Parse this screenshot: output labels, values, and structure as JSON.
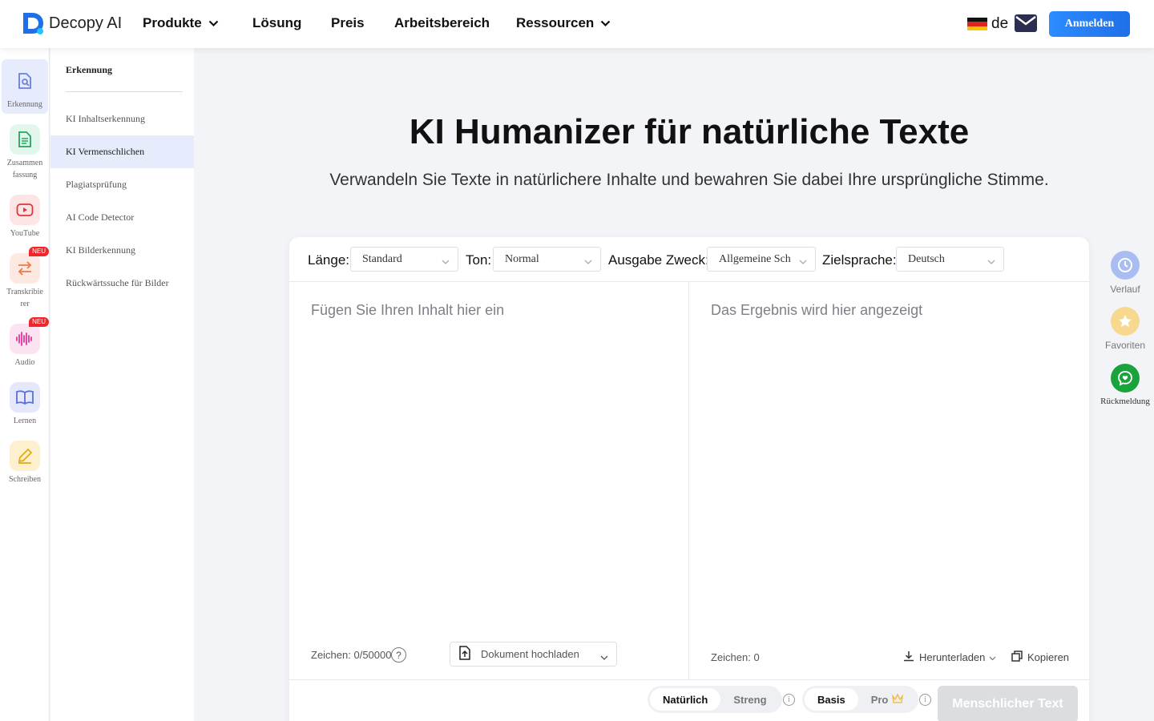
{
  "header": {
    "brand": "Decopy AI",
    "nav": [
      {
        "label": "Produkte",
        "dropdown": true
      },
      {
        "label": "Lösung",
        "dropdown": false
      },
      {
        "label": "Preis",
        "dropdown": false
      },
      {
        "label": "Arbeitsbereich",
        "dropdown": false
      },
      {
        "label": "Ressourcen",
        "dropdown": true
      }
    ],
    "lang_code": "de",
    "login_label": "Anmelden",
    "accent": "#2d8cff"
  },
  "rail": {
    "items": [
      {
        "label": "Erkennung",
        "icon": "document-search-icon",
        "active": true,
        "badge": ""
      },
      {
        "label": "Zusammen fassung",
        "icon": "document-lines-icon",
        "active": false,
        "badge": ""
      },
      {
        "label": "YouTube",
        "icon": "youtube-icon",
        "active": false,
        "badge": ""
      },
      {
        "label": "Transkribie rer",
        "icon": "arrows-swap-icon",
        "active": false,
        "badge": "NEU"
      },
      {
        "label": "Audio",
        "icon": "audio-wave-icon",
        "active": false,
        "badge": "NEU"
      },
      {
        "label": "Lernen",
        "icon": "book-icon",
        "active": false,
        "badge": ""
      },
      {
        "label": "Schreiben",
        "icon": "pen-icon",
        "active": false,
        "badge": ""
      }
    ]
  },
  "subnav": {
    "title": "Erkennung",
    "items": [
      {
        "label": "KI Inhaltserkennung",
        "active": false
      },
      {
        "label": "KI Vermenschlichen",
        "active": true
      },
      {
        "label": "Plagiatsprüfung",
        "active": false
      },
      {
        "label": "AI Code Detector",
        "active": false
      },
      {
        "label": "KI Bilderkennung",
        "active": false
      },
      {
        "label": "Rückwärtssuche für Bilder",
        "active": false
      }
    ]
  },
  "main": {
    "title": "KI Humanizer für natürliche Texte",
    "subtitle": "Verwandeln Sie Texte in natürlichere Inhalte und bewahren Sie dabei Ihre ursprüngliche Stimme."
  },
  "options": {
    "length_label": "Länge:",
    "length_value": "Standard",
    "tone_label": "Ton:",
    "tone_value": "Normal",
    "purpose_label": "Ausgabe Zweck:",
    "purpose_value": "Allgemeine Sch",
    "target_label": "Zielsprache:",
    "target_value": "Deutsch"
  },
  "editor": {
    "input_placeholder": "Fügen Sie Ihren Inhalt hier ein",
    "output_placeholder": "Das Ergebnis wird hier angezeigt",
    "input_count": "Zeichen: 0/50000",
    "output_count": "Zeichen: 0",
    "help": "?",
    "upload_label": "Dokument hochladen",
    "download_label": "Herunterladen",
    "copy_label": "Kopieren"
  },
  "modes": {
    "style": [
      "Natürlich",
      "Streng"
    ],
    "tier": [
      "Basis",
      "Pro"
    ],
    "info": "i",
    "submit_label": "Menschlicher Text"
  },
  "right_rail": [
    {
      "label": "Verlauf",
      "icon": "clock-icon",
      "color": "#a9bdf2"
    },
    {
      "label": "Favoriten",
      "icon": "star-icon",
      "color": "#f6d88f"
    },
    {
      "label": "Rückmeldung",
      "icon": "feedback-icon",
      "color": "#1aa33c"
    }
  ]
}
